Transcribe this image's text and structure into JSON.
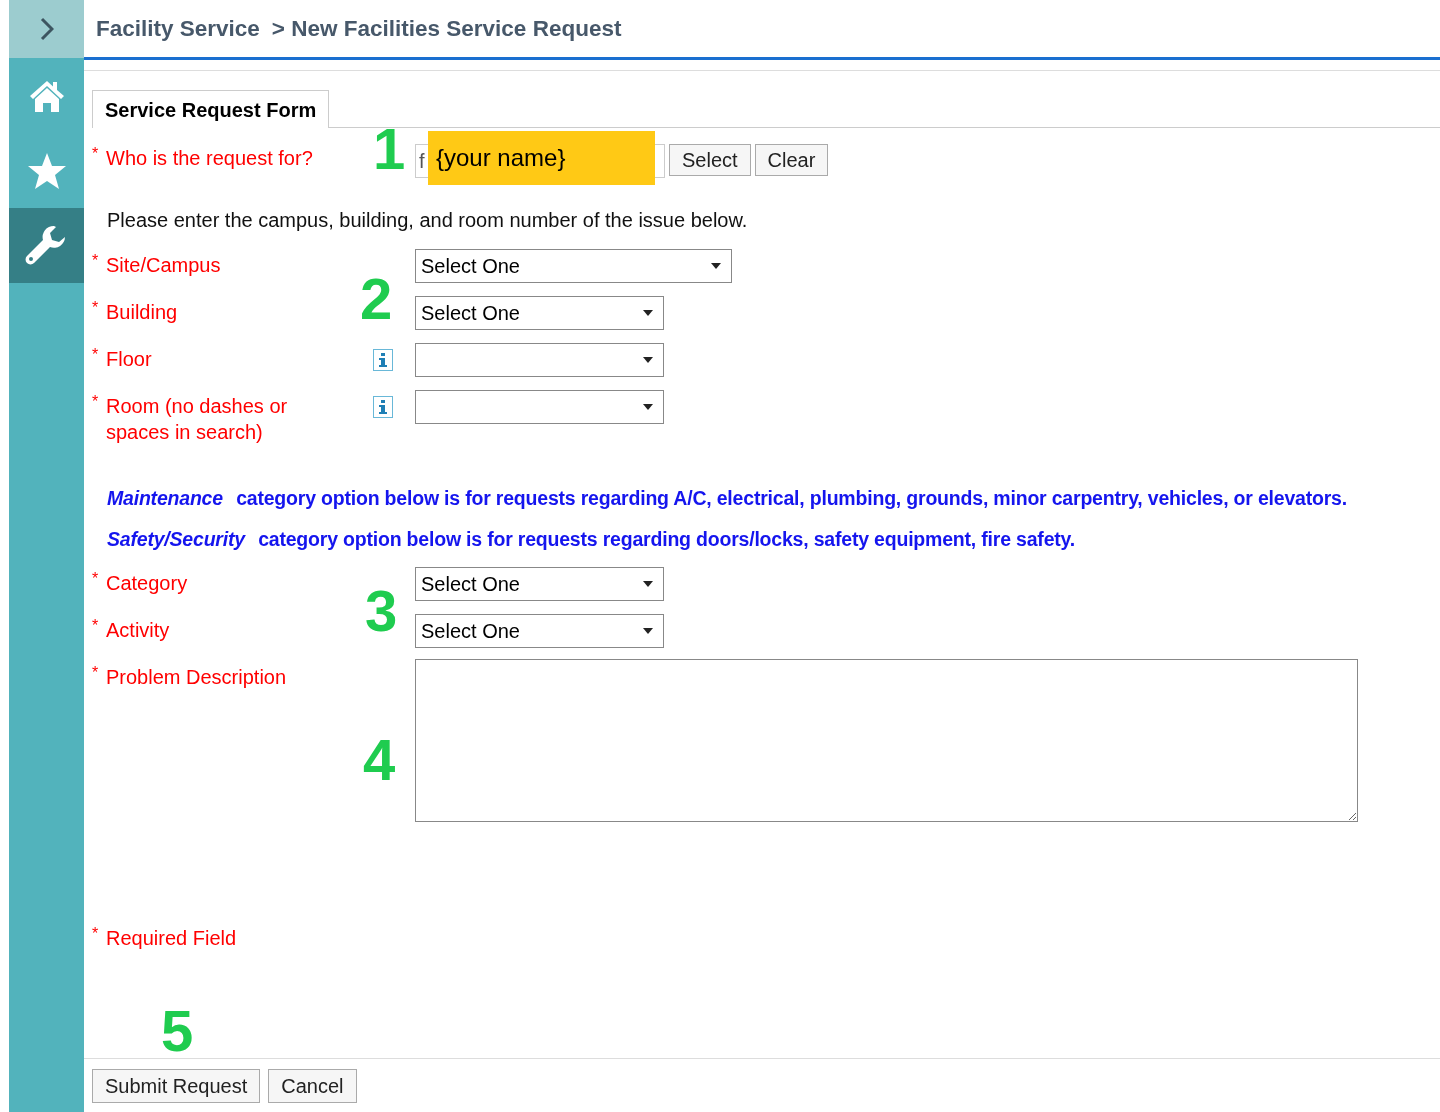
{
  "header": {
    "breadcrumb": [
      "Facility Service",
      "> New Facilities Service Request"
    ]
  },
  "sidebar": {
    "items": [
      {
        "kind": "home",
        "selected": false
      },
      {
        "kind": "star",
        "selected": false
      },
      {
        "kind": "wrench",
        "selected": true
      }
    ]
  },
  "tabs": [
    {
      "label": "Service Request Form",
      "selected": true
    }
  ],
  "required_mark": "*",
  "requester": {
    "label": "Who is the request for?",
    "required": true,
    "value": "f",
    "redaction": "{your name}",
    "buttons": [
      "Select",
      "Clear"
    ]
  },
  "instruction": "Please enter the campus, building, and room number of the issue below.",
  "location_fields": [
    {
      "label": "Site/Campus",
      "required": true,
      "info": false,
      "value": "Select One"
    },
    {
      "label": "Building",
      "required": true,
      "info": false,
      "value": "Select One"
    },
    {
      "label": "Floor",
      "required": true,
      "info": true
    },
    {
      "label": "Room (no dashes or spaces in search)",
      "required": true,
      "info": true
    }
  ],
  "notes": [
    {
      "term": "Maintenance",
      "text": "category option below is for requests regarding A/C, electrical, plumbing, grounds, minor carpentry, vehicles, or elevators."
    },
    {
      "term": "Safety/Security",
      "text": "category option below is for requests regarding doors/locks, safety equipment, fire safety."
    }
  ],
  "category_fields": [
    {
      "label": "Category",
      "required": true,
      "value": "Select One"
    },
    {
      "label": "Activity",
      "required": true,
      "value": "Select One"
    }
  ],
  "description": {
    "label": "Problem Description",
    "required": true
  },
  "required_note": "Required Field",
  "annotations": [
    "1",
    "2",
    "3",
    "4",
    "5"
  ],
  "footer_buttons": [
    "Submit Request",
    "Cancel"
  ]
}
